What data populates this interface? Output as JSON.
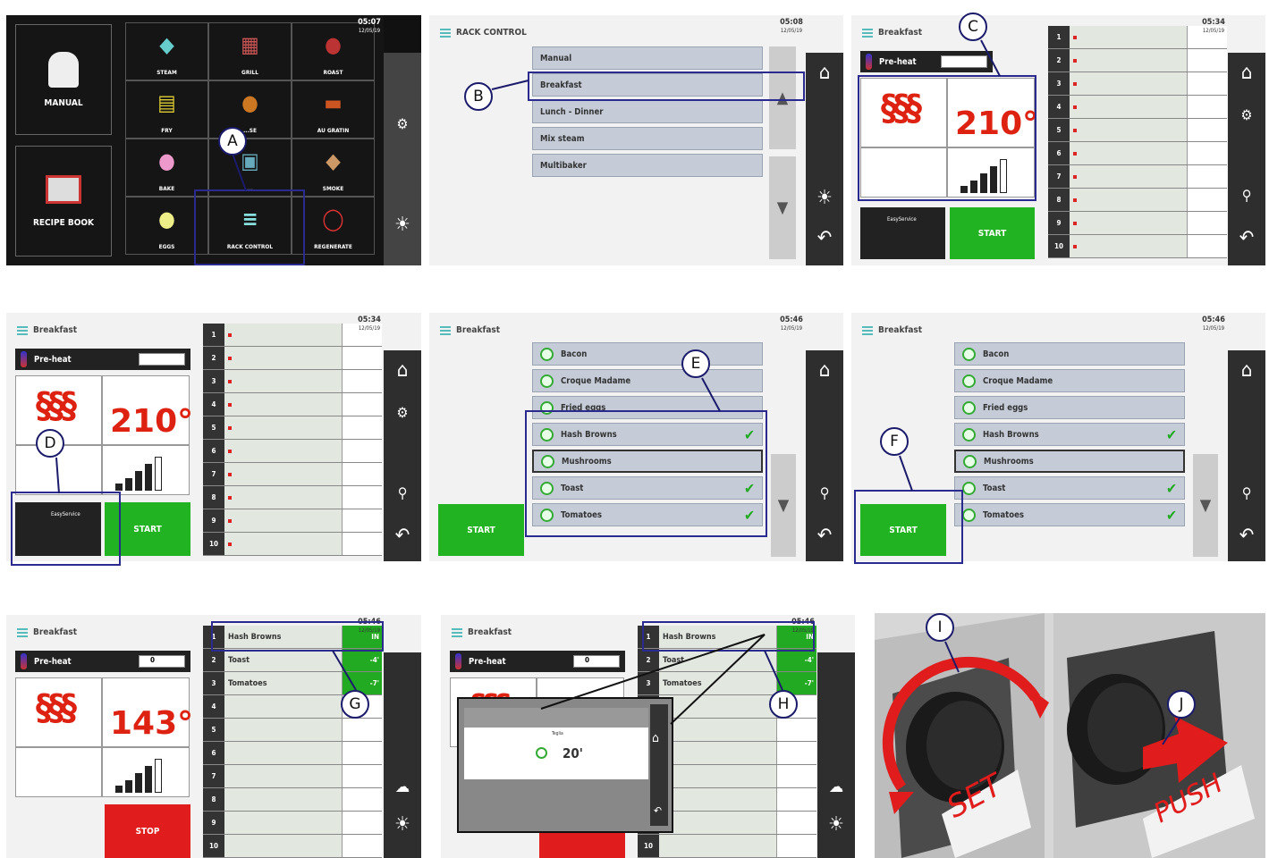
{
  "clock": {
    "p1": "05:07",
    "p2": "05:08",
    "p3": "05:34",
    "p4": "05:34",
    "p5": "05:46",
    "p6": "05:46",
    "p7": "05:46",
    "p8": "05:46",
    "date": "12/05/19"
  },
  "panel1": {
    "manual": "MANUAL",
    "recipe_book": "RECIPE BOOK",
    "tiles": [
      "STEAM",
      "GRILL",
      "ROAST",
      "FRY",
      "...SE",
      "AU GRATIN",
      "BAKE",
      "...",
      "SMOKE",
      "EGGS",
      "RACK CONTROL",
      "REGENERATE"
    ]
  },
  "panel2": {
    "title": "RACK CONTROL",
    "items": [
      "Manual",
      "Breakfast",
      "Lunch - Dinner",
      "Mix steam",
      "Multibaker"
    ]
  },
  "breakfast_title": "Breakfast",
  "preheat": "Pre-heat",
  "temp_a": "210°",
  "temp_b": "143°",
  "easyservice": "EasyService",
  "start": "START",
  "stop": "STOP",
  "rack_numbers": [
    "1",
    "2",
    "3",
    "4",
    "5",
    "6",
    "7",
    "8",
    "9",
    "10"
  ],
  "recipes": [
    "Bacon",
    "Croque Madame",
    "Fried eggs",
    "Hash Browns",
    "Mushrooms",
    "Toast",
    "Tomatoes"
  ],
  "running": {
    "rows": [
      {
        "name": "Hash Browns",
        "time": "IN"
      },
      {
        "name": "Toast",
        "time": "-4'"
      },
      {
        "name": "Tomatoes",
        "time": "-7'"
      }
    ],
    "zero": "0"
  },
  "popup": {
    "label": "Teglia",
    "time": "20'"
  },
  "knob": {
    "set": "SET",
    "push": "PUSH"
  },
  "callouts": [
    "A",
    "B",
    "C",
    "D",
    "E",
    "F",
    "G",
    "H",
    "I",
    "J"
  ]
}
